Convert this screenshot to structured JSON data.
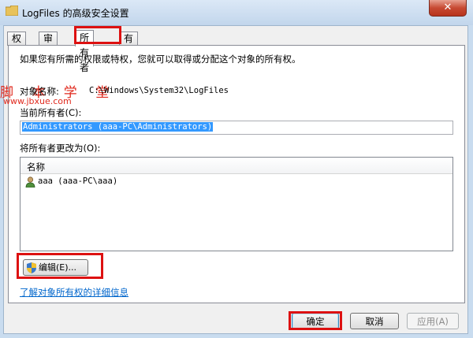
{
  "window": {
    "title": "LogFiles 的高级安全设置",
    "close_label": "✕"
  },
  "tabs": [
    {
      "label": "权限"
    },
    {
      "label": "审核"
    },
    {
      "label": "所有者"
    },
    {
      "label": "有效权限"
    }
  ],
  "active_tab": "所有者",
  "owner_tab": {
    "intro": "如果您有所需的权限或特权，您就可以取得或分配这个对象的所有权。",
    "object_name_label": "对象名称:",
    "object_name_value": "C:\\Windows\\System32\\LogFiles",
    "current_owner_label": "当前所有者(C):",
    "current_owner_value": "Administrators (aaa-PC\\Administrators)",
    "change_owner_label": "将所有者更改为(O):",
    "list_header": "名称",
    "list_items": [
      "aaa (aaa-PC\\aaa)"
    ],
    "edit_button": "编辑(E)...",
    "details_link": "了解对象所有权的详细信息"
  },
  "footer": {
    "ok": "确定",
    "cancel": "取消",
    "apply": "应用(A)"
  },
  "watermark": {
    "title": "脚 本 学 堂",
    "url": "www.jbxue.com"
  },
  "colors": {
    "highlight_box": "#dd1111",
    "selection": "#3399ff",
    "link": "#0066cc",
    "watermark": "#e0291d"
  }
}
